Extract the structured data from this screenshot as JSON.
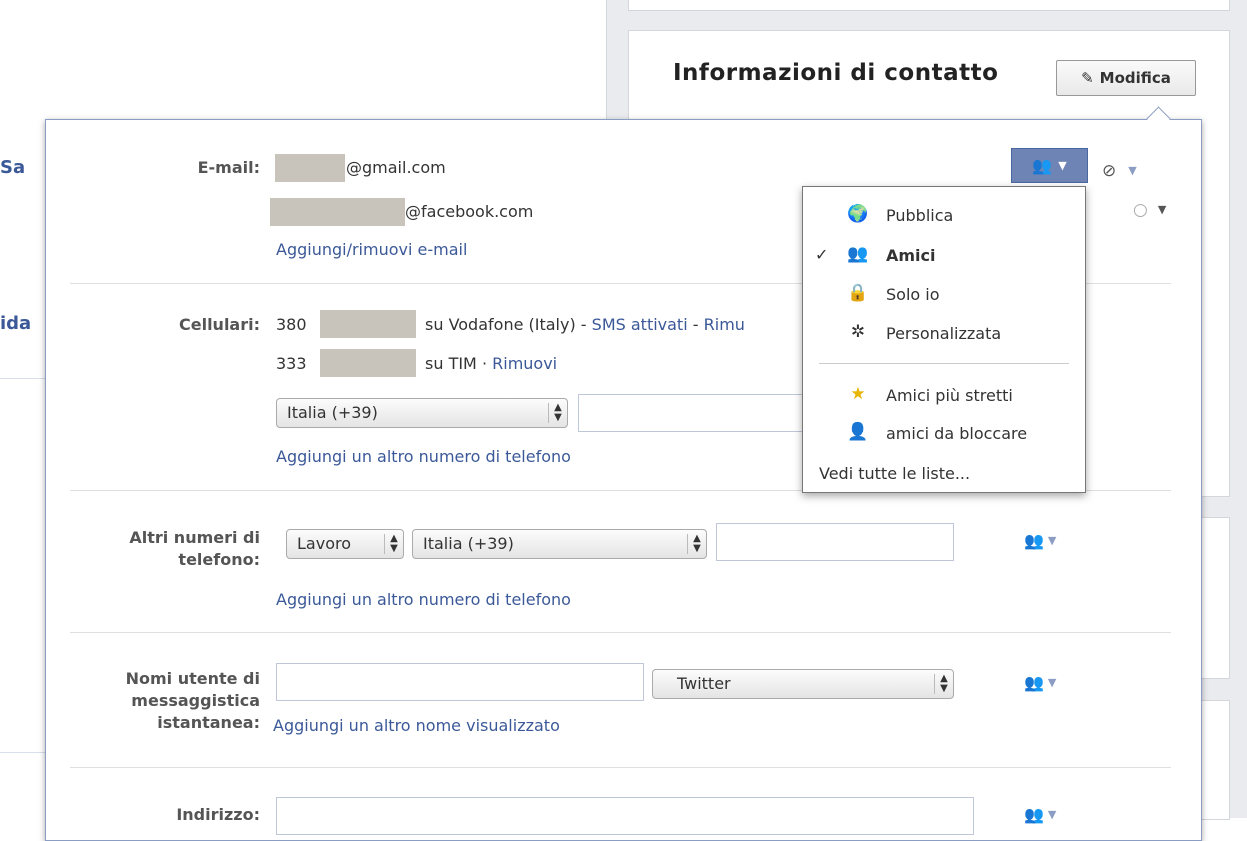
{
  "background": {
    "left_fragments": [
      "Sa",
      "ida"
    ],
    "contact_title": "Informazioni di contatto",
    "edit_button": "Modifica"
  },
  "email": {
    "label": "E-mail:",
    "addresses": [
      "@gmail.com",
      "@facebook.com"
    ],
    "add_link": "Aggiungi/rimuovi e-mail"
  },
  "mobile": {
    "label": "Cellulari:",
    "rows": [
      {
        "prefix": "380",
        "carrier": "su Vodafone (Italy) -",
        "sms": "SMS attivati",
        "sep": "-",
        "remove": "Rimu"
      },
      {
        "prefix": "333",
        "carrier": "su TIM ·",
        "remove": "Rimuovi"
      }
    ],
    "country_select": "Italia (+39)",
    "add_link": "Aggiungi un altro numero di telefono"
  },
  "other_phones": {
    "label_line1": "Altri numeri di",
    "label_line2": "telefono:",
    "type_select": "Lavoro",
    "country_select": "Italia (+39)",
    "add_link": "Aggiungi un altro numero di telefono"
  },
  "im": {
    "label_line1": "Nomi utente di",
    "label_line2": "messaggistica",
    "label_line3": "istantanea:",
    "service_select": "Twitter",
    "add_link": "Aggiungi un altro nome visualizzato"
  },
  "address": {
    "label": "Indirizzo:"
  },
  "privacy_menu": {
    "items": [
      {
        "label": "Pubblica",
        "icon": "globe-icon",
        "checked": false
      },
      {
        "label": "Amici",
        "icon": "friends-icon",
        "checked": true
      },
      {
        "label": "Solo io",
        "icon": "lock-icon",
        "checked": false
      },
      {
        "label": "Personalizzata",
        "icon": "gear-icon",
        "checked": false
      }
    ],
    "lists": [
      {
        "label": "Amici più stretti",
        "icon": "star-list-icon"
      },
      {
        "label": "amici da bloccare",
        "icon": "person-list-icon"
      }
    ],
    "see_all": "Vedi tutte le liste..."
  }
}
